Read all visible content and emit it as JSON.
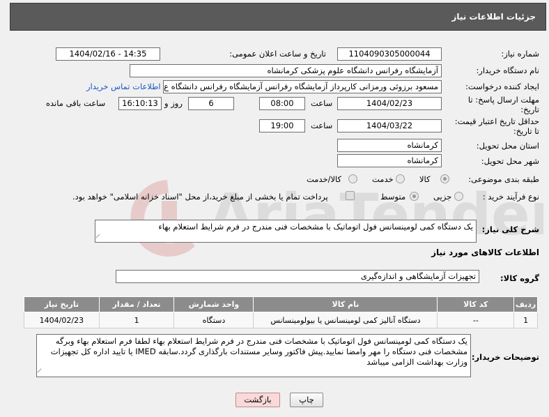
{
  "header": {
    "title": "جزئیات اطلاعات نیاز"
  },
  "fields": {
    "need_number_label": "شماره نیاز:",
    "need_number": "1104090305000044",
    "announce_label": "تاریخ و ساعت اعلان عمومی:",
    "announce_value": "1404/02/16 - 14:35",
    "buyer_org_label": "نام دستگاه خریدار:",
    "buyer_org": "آزمایشگاه رفرانس دانشگاه علوم پزشکی کرمانشاه",
    "requester_label": "ایجاد کننده درخواست:",
    "requester": "مسعود برزوئی ورمزانی کارپرداز آزمایشگاه رفرانس آزمایشگاه رفرانس دانشگاه ع",
    "contact_link": "اطلاعات تماس خریدار",
    "deadline_label_1": "مهلت ارسال پاسخ: تا",
    "deadline_label_2": "تاریخ:",
    "deadline_date": "1404/02/23",
    "time_label": "ساعت",
    "deadline_time": "08:00",
    "days_value": "6",
    "days_label": "روز و",
    "remaining_time": "16:10:13",
    "remaining_label": "ساعت باقی مانده",
    "min_validity_label_1": "حداقل تاریخ اعتبار قیمت:",
    "min_validity_label_2": "تا تاریخ:",
    "validity_date": "1404/03/22",
    "validity_time_label": "ساعت",
    "validity_time": "19:00",
    "province_label": "استان محل تحویل:",
    "province": "کرمانشاه",
    "city_label": "شهر محل تحویل:",
    "city": "کرمانشاه",
    "category_label": "طبقه بندی موضوعی:",
    "category_options": [
      "کالا",
      "خدمت",
      "کالا/خدمت"
    ],
    "purchase_type_label": "نوع فرآیند خرید :",
    "purchase_options": [
      "جزیی",
      "متوسط"
    ],
    "payment_note": "پرداخت تمام یا بخشی از مبلغ خرید،از محل \"اسناد خزانه اسلامی\" خواهد بود."
  },
  "description": {
    "label": "شرح کلی نیاز:",
    "text": "یک دستگاه کمی لومینسانس فول اتوماتیک با مشخصات فنی مندرج در فرم شرایط استعلام بهاء"
  },
  "goods_info_title": "اطلاعات کالاهای مورد نیاز",
  "goods_group": {
    "label": "گروه کالا:",
    "value": "تجهیزات آزمایشگاهی و اندازه‌گیری"
  },
  "table": {
    "headers": [
      "ردیف",
      "کد کالا",
      "نام کالا",
      "واحد شمارش",
      "تعداد / مقدار",
      "تاریخ نیاز"
    ],
    "rows": [
      [
        "1",
        "--",
        "دستگاه آنالیز کمی لومینسانس یا بیولومینسانس",
        "دستگاه",
        "1",
        "1404/02/23"
      ]
    ]
  },
  "buyer_notes": {
    "label": "توضیحات خریدار:",
    "text": "یک دستگاه کمی لومینسانس فول اتوماتیک با مشخصات فنی مندرج در فرم شرایط استعلام بهاء لطفا فرم استعلام بهاء وبرگه مشخصات فنی دستگاه را مهر وامضا نمایید.پیش فاکتور وسایر مستندات بارگذاری گردد.سابقه IMED یا تایید اداره کل تجهیزات وزارت بهداشت الزامی میباشد"
  },
  "buttons": {
    "print": "چاپ",
    "back": "بازگشت"
  },
  "watermark_text": "AriaTender.neT",
  "colors": {
    "header_bg": "#5a5a5a",
    "link": "#1a56c4",
    "table_header": "#8c8c8c",
    "back_button": "#f9d9d9"
  }
}
